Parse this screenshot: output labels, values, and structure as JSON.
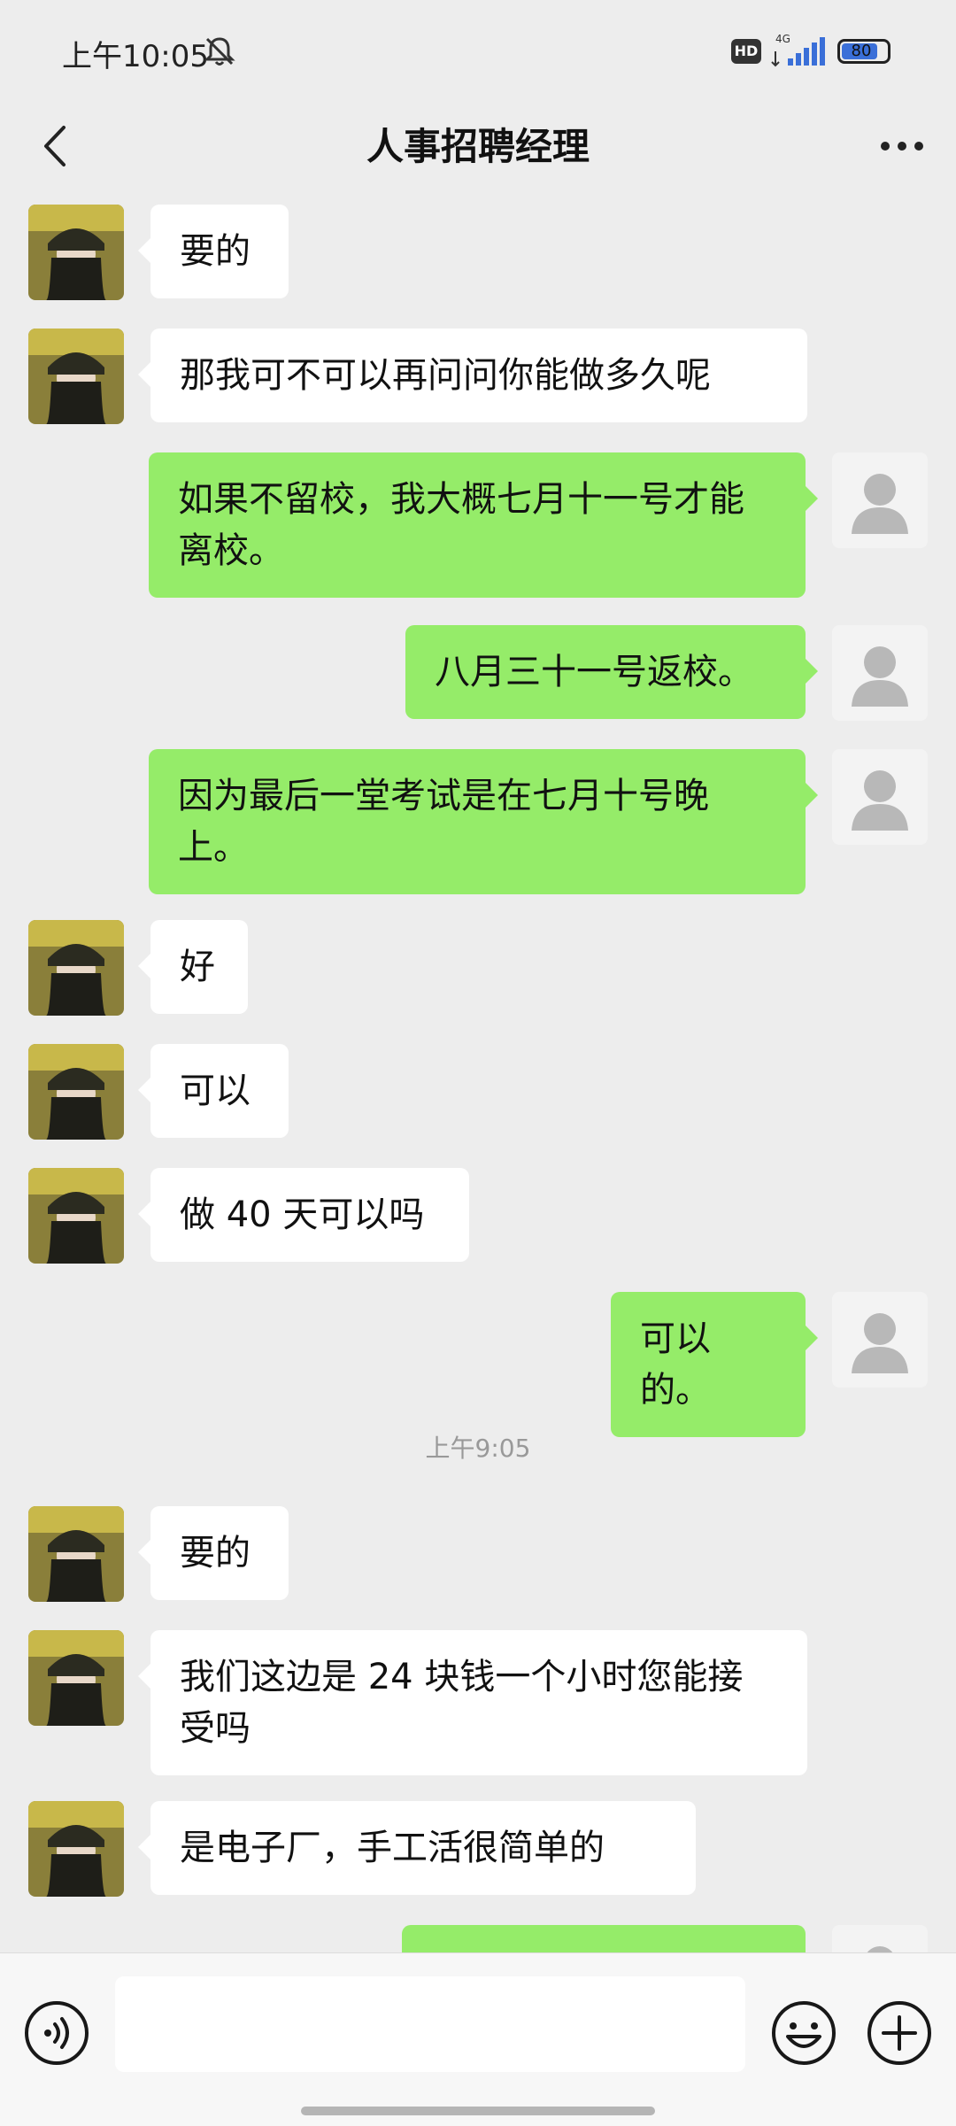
{
  "status_bar": {
    "time": "上午10:05",
    "network": "4G",
    "hd": "HD",
    "battery_level": "80"
  },
  "header": {
    "title": "人事招聘经理"
  },
  "messages": [
    {
      "side": "in",
      "text": "要的"
    },
    {
      "side": "in",
      "text": "那我可不可以再问问你能做多久呢"
    },
    {
      "side": "out",
      "text": "如果不留校，我大概七月十一号才能离校。"
    },
    {
      "side": "out",
      "text": "八月三十一号返校。"
    },
    {
      "side": "out",
      "text": "因为最后一堂考试是在七月十号晚上。"
    },
    {
      "side": "in",
      "text": "好"
    },
    {
      "side": "in",
      "text": "可以"
    },
    {
      "side": "in",
      "text": "做 40 天可以吗"
    },
    {
      "side": "out",
      "text": "可以的。"
    },
    {
      "type": "timestamp",
      "text": "上午9:05"
    },
    {
      "side": "in",
      "text": "要的"
    },
    {
      "side": "in",
      "text": "我们这边是 24 块钱一个小时您能接受吗"
    },
    {
      "side": "in",
      "text": "是电子厂，手工活很简单的"
    },
    {
      "side": "out",
      "text": ""
    }
  ],
  "input": {
    "value": "",
    "placeholder": ""
  },
  "icons": {
    "back": "chevron-left-icon",
    "more": "more-dots-icon",
    "bell": "bell-off-icon",
    "voice": "voice-icon",
    "emoji": "emoji-icon",
    "plus": "plus-icon"
  },
  "colors": {
    "outgoing_bubble": "#95ec69",
    "incoming_bubble": "#ffffff",
    "background": "#ededed"
  }
}
